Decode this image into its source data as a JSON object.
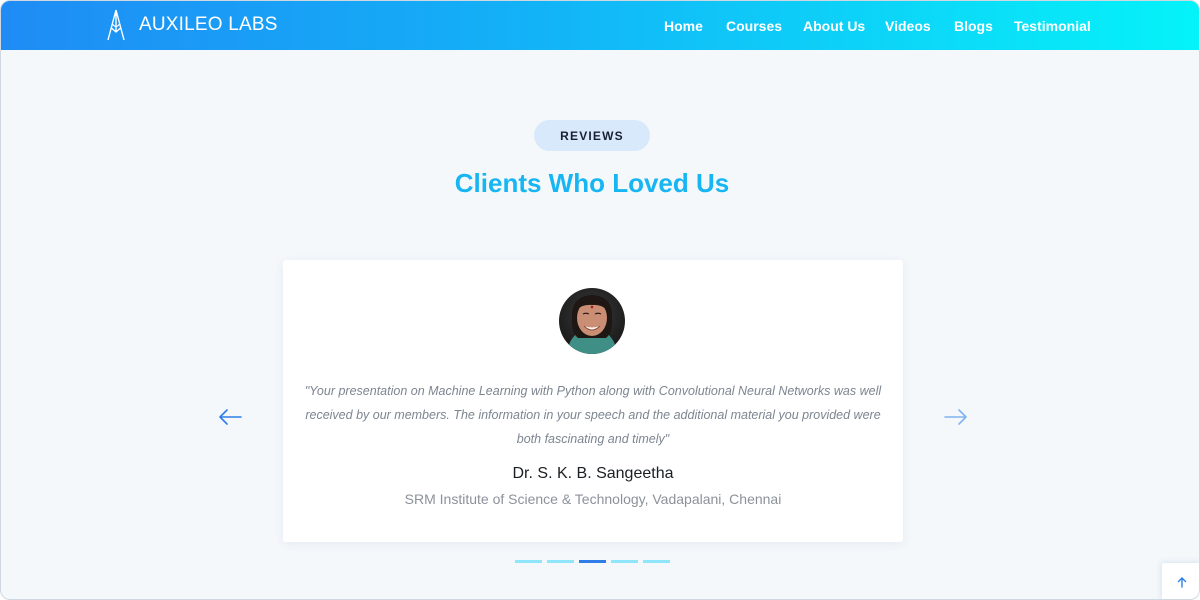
{
  "brand": {
    "name": "AUXILEO LABS"
  },
  "nav": {
    "items": [
      "Home",
      "Courses",
      "About Us",
      "Videos",
      "Blogs",
      "Testimonial"
    ]
  },
  "section": {
    "badge": "REVIEWS",
    "title": "Clients Who Loved Us"
  },
  "testimonial": {
    "quote": "\"Your presentation on Machine Learning with Python along with Convolutional Neural Networks was well received by our members. The information in your speech and the additional material you provided were both fascinating and timely\"",
    "name": "Dr. S. K. B. Sangeetha",
    "organization": "SRM Institute of Science & Technology, Vadapalani, Chennai"
  },
  "carousel": {
    "dot_count": 5,
    "active_index": 2,
    "prev_icon": "arrow-left-icon",
    "next_icon": "arrow-right-icon"
  },
  "colors": {
    "nav_gradient_start": "#1f8cf5",
    "nav_gradient_end": "#04f3f9",
    "title": "#17b6f2",
    "badge_bg": "#d8e9fb",
    "dot_active": "#2f7ee8",
    "dot_inactive": "#8fe6fb"
  },
  "icons": {
    "logo": "auxileo-logo-icon",
    "scroll_top": "arrow-up-icon"
  }
}
